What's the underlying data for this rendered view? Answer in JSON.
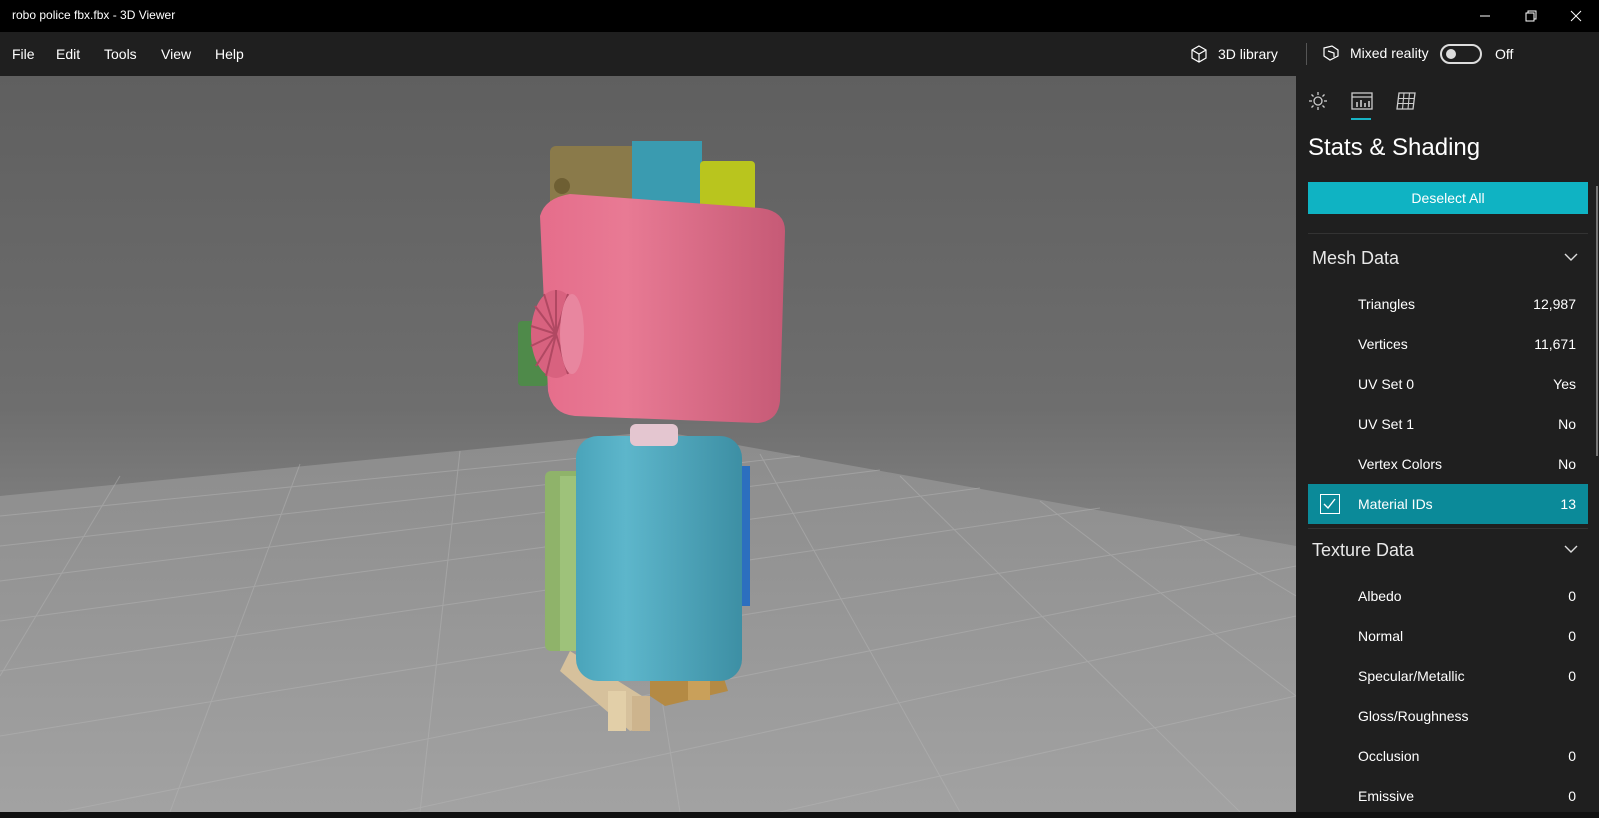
{
  "window": {
    "title": "robo police fbx.fbx - 3D Viewer",
    "minimize_icon": "minimize-icon",
    "maximize_icon": "restore-icon",
    "close_icon": "close-icon"
  },
  "menu": {
    "items": [
      "File",
      "Edit",
      "Tools",
      "View",
      "Help"
    ],
    "library_label": "3D library",
    "mixed_reality_label": "Mixed reality",
    "mixed_reality_state": "Off"
  },
  "panel": {
    "tabs": [
      "environment-lighting-icon",
      "stats-shading-icon",
      "grid-icon"
    ],
    "active_tab": 1,
    "title": "Stats & Shading",
    "deselect_label": "Deselect All",
    "accent_color": "#0fb3c3",
    "mesh": {
      "header": "Mesh Data",
      "rows": [
        {
          "label": "Triangles",
          "value": "12,987"
        },
        {
          "label": "Vertices",
          "value": "11,671"
        },
        {
          "label": "UV Set 0",
          "value": "Yes"
        },
        {
          "label": "UV Set 1",
          "value": "No"
        },
        {
          "label": "Vertex Colors",
          "value": "No"
        },
        {
          "label": "Material IDs",
          "value": "13"
        }
      ]
    },
    "texture": {
      "header": "Texture Data",
      "rows": [
        {
          "label": "Albedo",
          "value": "0"
        },
        {
          "label": "Normal",
          "value": "0"
        },
        {
          "label": "Specular/Metallic",
          "value": "0"
        },
        {
          "label": "Gloss/Roughness",
          "value": ""
        },
        {
          "label": "Occlusion",
          "value": "0"
        },
        {
          "label": "Emissive",
          "value": "0"
        }
      ]
    }
  }
}
